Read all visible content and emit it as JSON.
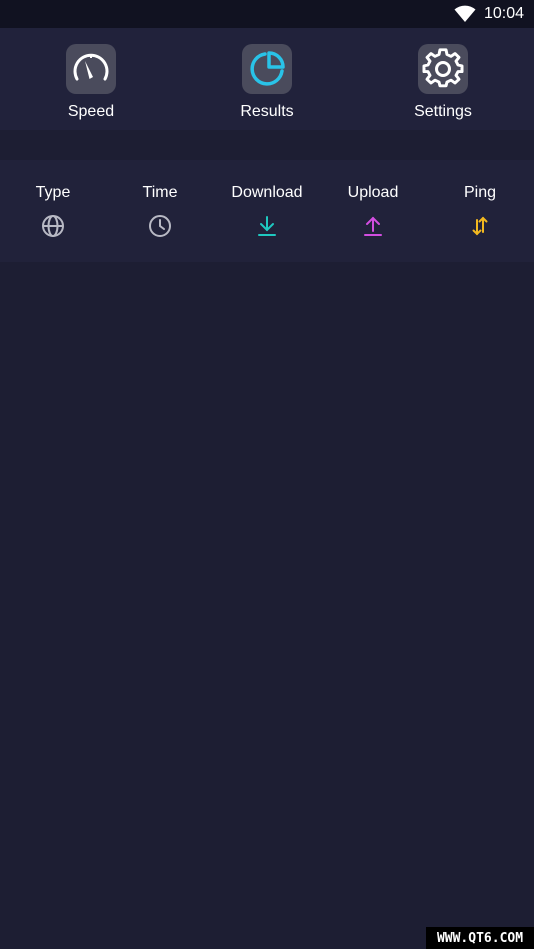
{
  "status_bar": {
    "time": "10:04"
  },
  "tabs": [
    {
      "label": "Speed",
      "icon": "speedometer-icon"
    },
    {
      "label": "Results",
      "icon": "pie-chart-icon"
    },
    {
      "label": "Settings",
      "icon": "gear-icon"
    }
  ],
  "columns": [
    {
      "label": "Type",
      "icon": "globe-icon"
    },
    {
      "label": "Time",
      "icon": "clock-icon"
    },
    {
      "label": "Download",
      "icon": "download-arrow-icon"
    },
    {
      "label": "Upload",
      "icon": "upload-arrow-icon"
    },
    {
      "label": "Ping",
      "icon": "ping-arrows-icon"
    }
  ],
  "colors": {
    "background": "#1d1e33",
    "panel": "#21223b",
    "status_bar": "#111221",
    "tile": "#4a4b5c",
    "results_accent": "#29c3e8",
    "download": "#1fc8c0",
    "upload": "#d24ee0",
    "ping": "#f2b820"
  },
  "watermark": "WWW.QT6.COM"
}
